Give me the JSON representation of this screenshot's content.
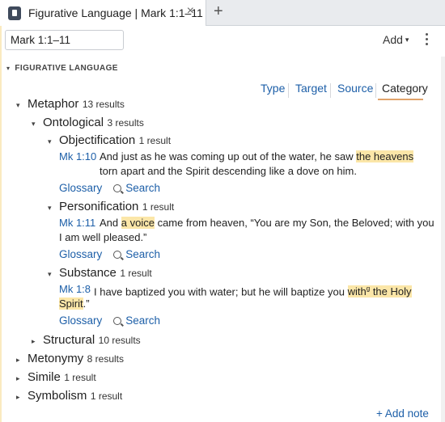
{
  "tab": {
    "title": "Figurative Language | Mark 1:1–11",
    "close": "×",
    "add": "+"
  },
  "toolbar": {
    "reference": "Mark 1:1–11",
    "add_label": "Add",
    "add_caret": "▾"
  },
  "section": {
    "caret": "▾",
    "title": "FIGURATIVE LANGUAGE"
  },
  "filters": [
    "Type",
    "Target",
    "Source",
    "Category"
  ],
  "active_filter": "Category",
  "tree": {
    "metaphor": {
      "label": "Metaphor",
      "count": "13 results"
    },
    "ontological": {
      "label": "Ontological",
      "count": "3 results"
    },
    "objectification": {
      "label": "Objectification",
      "count": "1 result",
      "ref": "Mk 1:10",
      "text_before": "And just as he was coming up out of the water, he saw ",
      "highlight": "the heavens",
      "text_line2": "torn apart and the Spirit descending like a dove on him."
    },
    "personification": {
      "label": "Personification",
      "count": "1 result",
      "ref": "Mk 1:11",
      "text_before": "And ",
      "highlight": "a voice",
      "text_after": " came from heaven, “You are my Son, the Beloved; with you",
      "text_line2": "I am well pleased.”"
    },
    "substance": {
      "label": "Substance",
      "count": "1 result",
      "ref": "Mk 1:8",
      "text_before": "I have baptized you with water; but he will baptize you ",
      "highlight": "with",
      "footnote": "g",
      "highlight2": " the Holy",
      "highlight_line2": "Spirit",
      "text_line2_after": ".”"
    },
    "structural": {
      "label": "Structural",
      "count": "10 results"
    },
    "metonymy": {
      "label": "Metonymy",
      "count": "8 results"
    },
    "simile": {
      "label": "Simile",
      "count": "1 result"
    },
    "symbolism": {
      "label": "Symbolism",
      "count": "1 result"
    }
  },
  "actions": {
    "glossary": "Glossary",
    "search": "Search"
  },
  "add_note": "+ Add note",
  "colors": {
    "link": "#1d5fa8",
    "highlight": "#fbe6a8",
    "active_underline": "#e0a26a"
  }
}
